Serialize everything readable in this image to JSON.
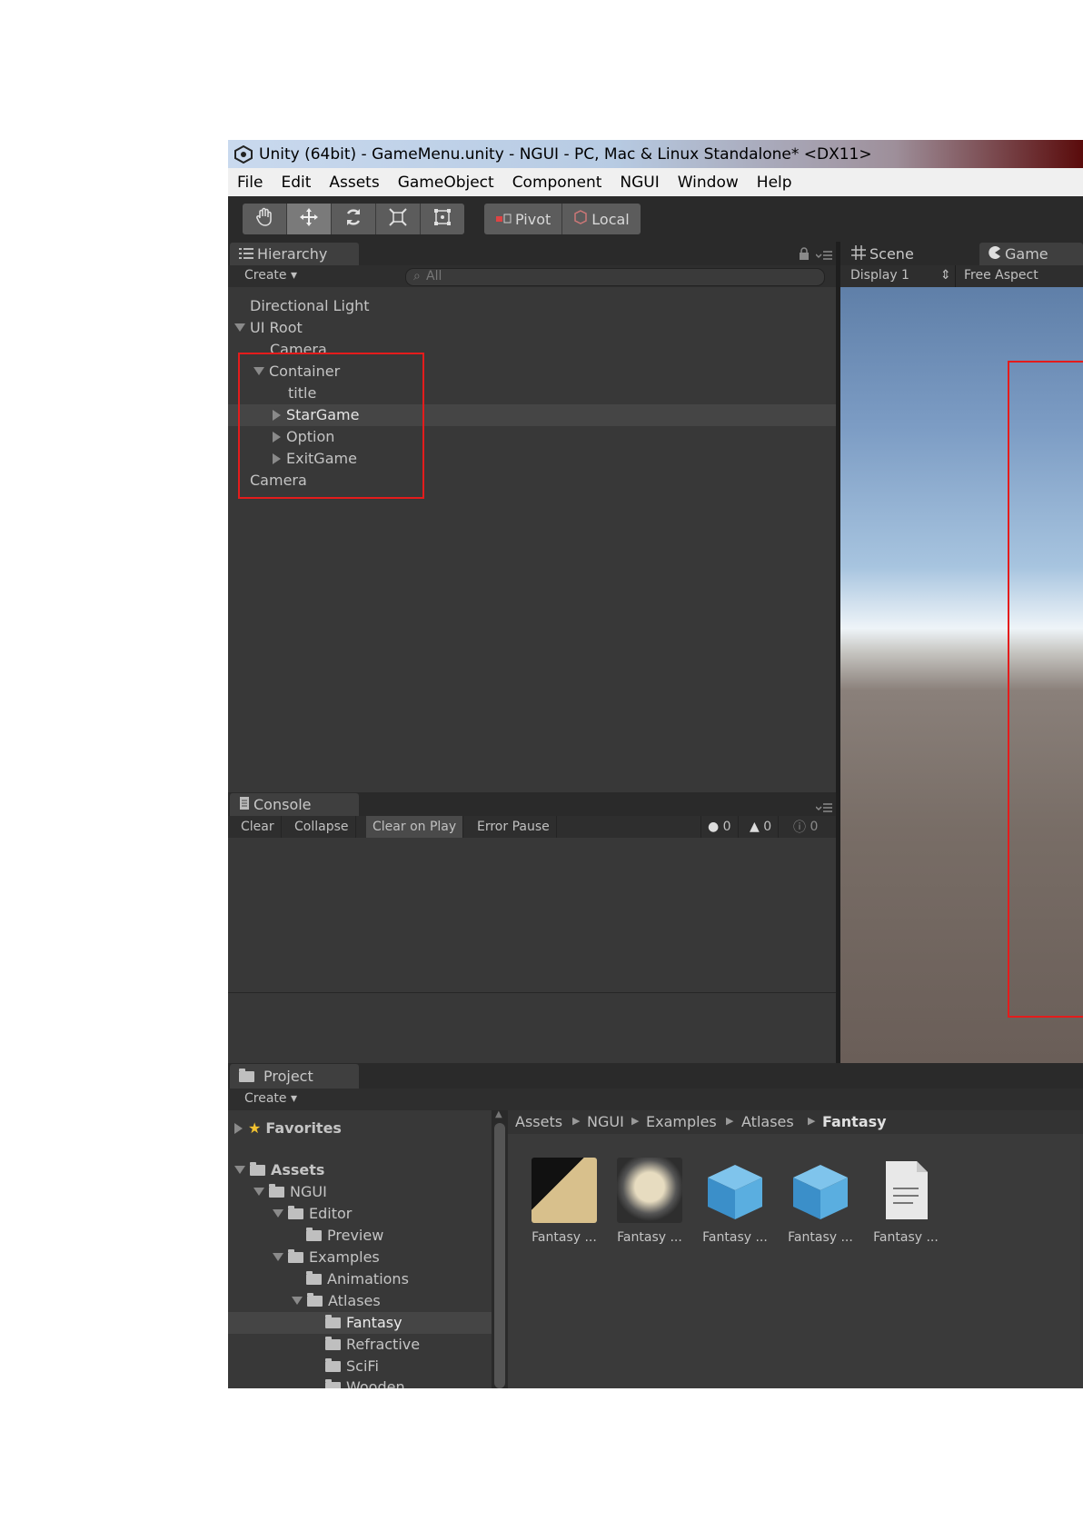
{
  "window": {
    "title": "Unity (64bit) - GameMenu.unity - NGUI - PC, Mac & Linux Standalone* <DX11>"
  },
  "menubar": [
    "File",
    "Edit",
    "Assets",
    "GameObject",
    "Component",
    "NGUI",
    "Window",
    "Help"
  ],
  "toolbar": {
    "tools": [
      "hand-icon",
      "move-icon",
      "rotate-icon",
      "scale-icon",
      "rect-icon"
    ],
    "pivot_label": "Pivot",
    "local_label": "Local"
  },
  "hierarchy": {
    "tab_label": "Hierarchy",
    "create_label": "Create",
    "search_placeholder": "All",
    "items": [
      {
        "label": "Directional Light"
      },
      {
        "label": "UI Root"
      },
      {
        "label": "Camera"
      },
      {
        "label": "Container"
      },
      {
        "label": "title"
      },
      {
        "label": "StarGame"
      },
      {
        "label": "Option"
      },
      {
        "label": "ExitGame"
      },
      {
        "label": "Camera"
      }
    ]
  },
  "scene": {
    "scene_tab": "Scene",
    "game_tab": "Game",
    "display_label": "Display 1",
    "aspect_label": "Free Aspect"
  },
  "console": {
    "tab_label": "Console",
    "buttons": [
      "Clear",
      "Collapse",
      "Clear on Play",
      "Error Pause"
    ],
    "counts": {
      "errors": "0",
      "warnings": "0",
      "messages": "0"
    }
  },
  "project": {
    "tab_label": "Project",
    "create_label": "Create",
    "tree": [
      {
        "label": "Favorites"
      },
      {
        "label": "Assets"
      },
      {
        "label": "NGUI"
      },
      {
        "label": "Editor"
      },
      {
        "label": "Preview"
      },
      {
        "label": "Examples"
      },
      {
        "label": "Animations"
      },
      {
        "label": "Atlases"
      },
      {
        "label": "Fantasy"
      },
      {
        "label": "Refractive"
      },
      {
        "label": "SciFi"
      },
      {
        "label": "Wooden"
      }
    ],
    "breadcrumb": [
      "Assets",
      "NGUI",
      "Examples",
      "Atlases",
      "Fantasy"
    ],
    "assets": [
      {
        "label": "Fantasy ..."
      },
      {
        "label": "Fantasy ..."
      },
      {
        "label": "Fantasy ..."
      },
      {
        "label": "Fantasy ..."
      },
      {
        "label": "Fantasy ..."
      }
    ]
  },
  "colors": {
    "editor_bg": "#383838",
    "highlight": "#e41c1c"
  }
}
